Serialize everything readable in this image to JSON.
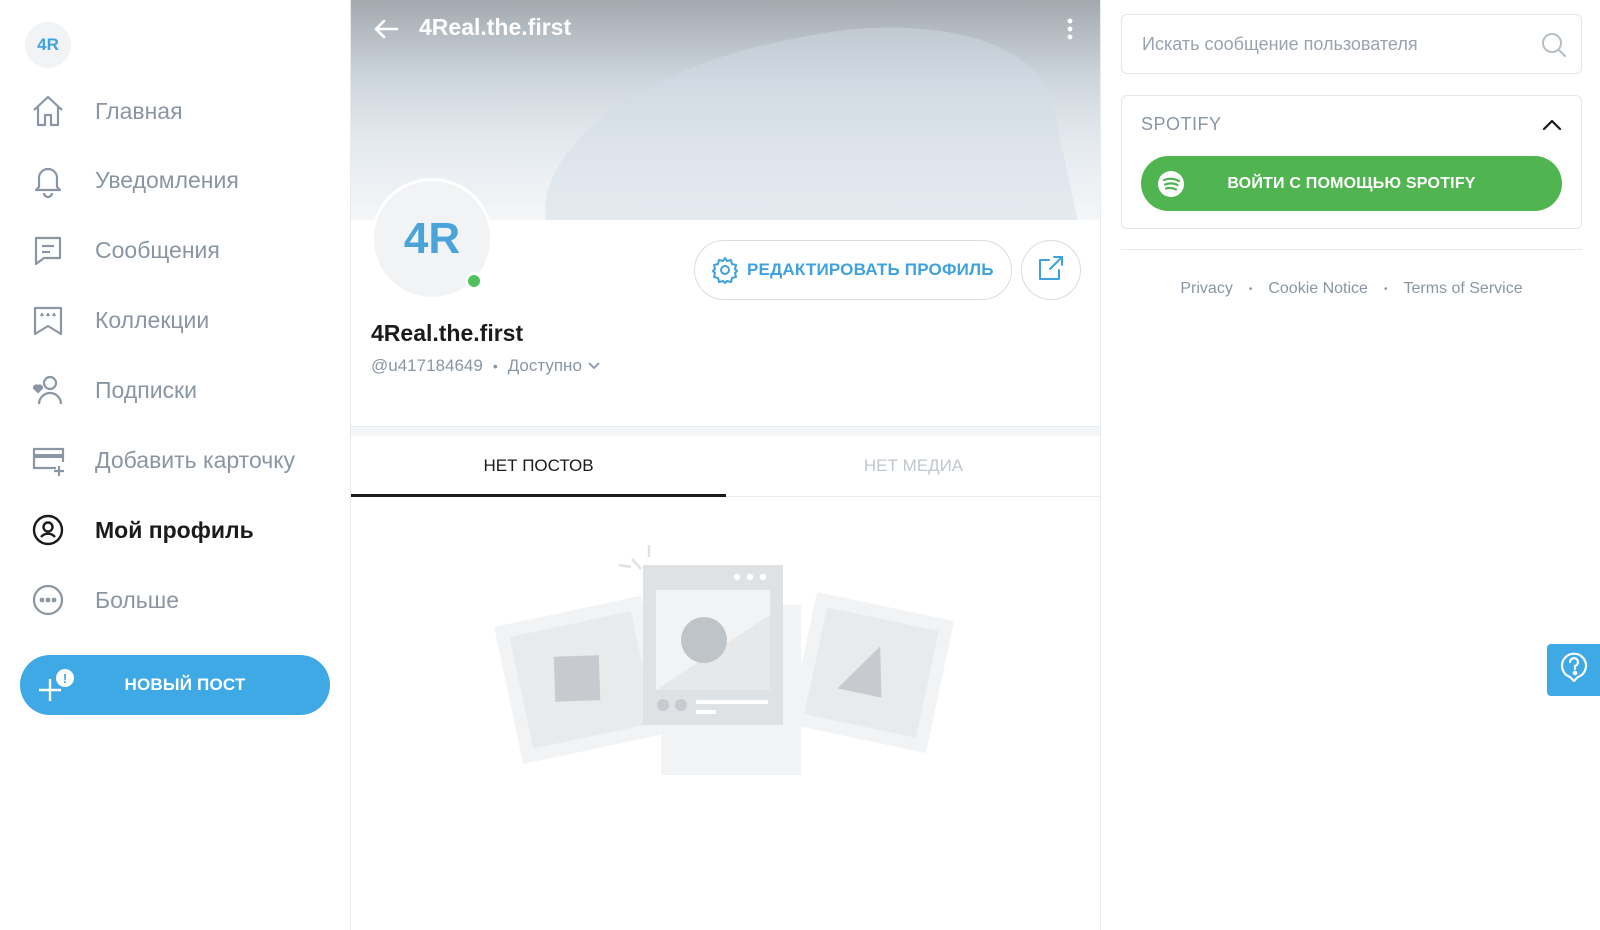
{
  "sidebar": {
    "avatar_initials": "4R",
    "items": [
      {
        "label": "Главная",
        "icon": "home-icon"
      },
      {
        "label": "Уведомления",
        "icon": "bell-icon"
      },
      {
        "label": "Сообщения",
        "icon": "message-icon"
      },
      {
        "label": "Коллекции",
        "icon": "bookmark-stars-icon"
      },
      {
        "label": "Подписки",
        "icon": "subscriptions-icon"
      },
      {
        "label": "Добавить карточку",
        "icon": "card-add-icon"
      },
      {
        "label": "Мой профиль",
        "icon": "profile-circle-icon",
        "active": true
      },
      {
        "label": "Больше",
        "icon": "more-icon"
      }
    ],
    "new_post_label": "НОВЫЙ ПОСТ",
    "new_post_badge": "!"
  },
  "header": {
    "title": "4Real.the.first"
  },
  "profile": {
    "avatar_initials": "4R",
    "display_name": "4Real.the.first",
    "username": "@u417184649",
    "separator": "•",
    "status": "Доступно",
    "online": true,
    "edit_button_label": "РЕДАКТИРОВАТЬ ПРОФИЛЬ"
  },
  "tabs": [
    {
      "label": "НЕТ ПОСТОВ",
      "active": true
    },
    {
      "label": "НЕТ МЕДИА",
      "active": false
    }
  ],
  "search": {
    "placeholder": "Искать сообщение пользователя"
  },
  "spotify": {
    "title": "SPOTIFY",
    "button_label": "ВОЙТИ С ПОМОЩЬЮ SPOTIFY"
  },
  "footer": {
    "links": [
      "Privacy",
      "Cookie Notice",
      "Terms of Service"
    ],
    "separator": "•"
  },
  "colors": {
    "accent": "#3fa9e6",
    "spotify_green": "#50b550",
    "online": "#4fc35b",
    "muted": "#8a96a3"
  }
}
